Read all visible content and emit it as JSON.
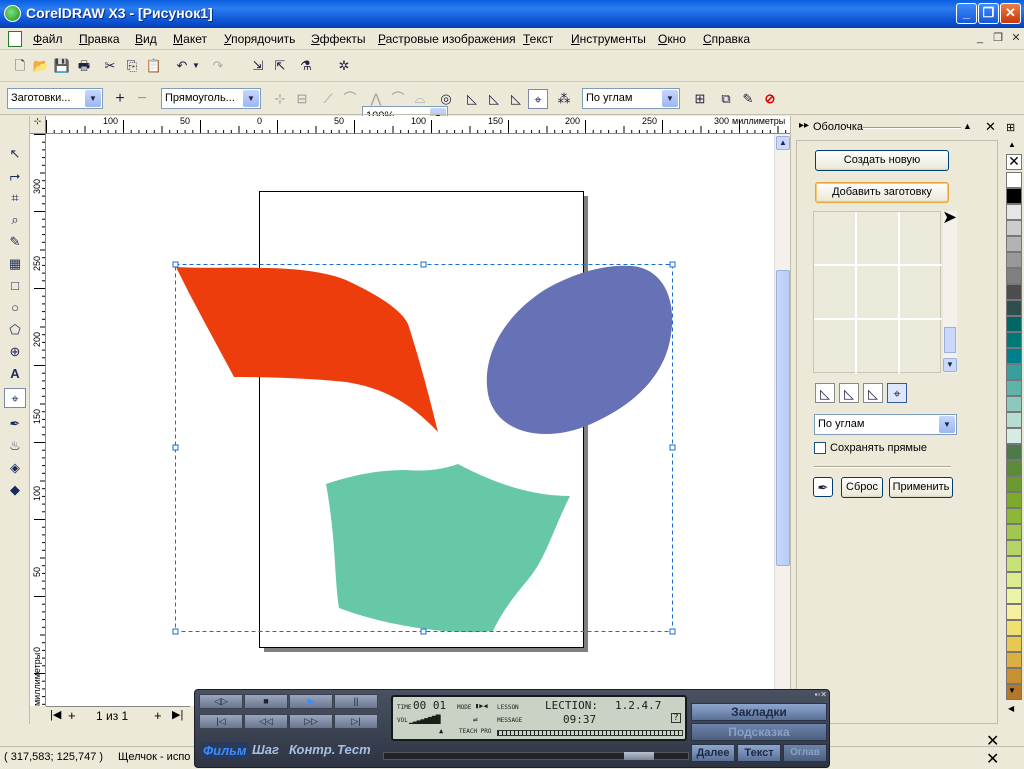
{
  "window": {
    "title": "CorelDRAW X3 - [Рисунок1]"
  },
  "menu": [
    "Файл",
    "Правка",
    "Вид",
    "Макет",
    "Упорядочить",
    "Эффекты",
    "Растровые изображения",
    "Текст",
    "Инструменты",
    "Окно",
    "Справка"
  ],
  "toolbar1": {
    "zoom": "100%"
  },
  "toolbar2": {
    "preset": "Заготовки...",
    "shape_preset": "Прямоуголь...",
    "mapping_mode": "По углам"
  },
  "ruler": {
    "h_labels": [
      "100",
      "50",
      "0",
      "50",
      "100",
      "150",
      "200",
      "250",
      "300"
    ],
    "h_unit": "миллиметры",
    "v_labels": [
      "300",
      "250",
      "200",
      "150",
      "100",
      "50",
      "0"
    ],
    "v_unit": "миллиметры"
  },
  "pagebar": {
    "page_label": "1 из 1"
  },
  "statusbar": {
    "coords": "( 317,583; 125,747 )",
    "hint": "Щелчок - испо"
  },
  "docker": {
    "title": "Оболочка",
    "create_new": "Создать новую",
    "add_preset": "Добавить заготовку",
    "mapping_mode": "По углам",
    "keep_lines": "Сохранять прямые",
    "reset": "Сброс",
    "apply": "Применить"
  },
  "colors": {
    "orange_shape": "#ee3d0c",
    "blue_shape": "#6672b5",
    "green_shape": "#66c8a6"
  },
  "palette": [
    "#ffffff",
    "#000000",
    "#e6e6e6",
    "#cccccc",
    "#b3b3b3",
    "#999999",
    "#808080",
    "#4d4d4d",
    "#2f4f4f",
    "#006666",
    "#007878",
    "#00808c",
    "#3b9e9e",
    "#5fb3a8",
    "#8cc9bc",
    "#b7ddd0",
    "#d6ece2",
    "#4c7a4c",
    "#5a8a3a",
    "#6b9a32",
    "#7caa2a",
    "#8cb83a",
    "#a0c850",
    "#b4d466",
    "#c8e07a",
    "#dceb90",
    "#ecf4a8",
    "#f6f0a0",
    "#f0e070",
    "#e8c850",
    "#dcb040",
    "#c89030",
    "#b47828"
  ],
  "player": {
    "transport": [
      "◁▷",
      "■",
      "▶",
      "||",
      "|◁",
      "◁◁",
      "▷▷",
      "▷|"
    ],
    "tabs": [
      "Фильм",
      "Шаг",
      "Контр.",
      "Тест"
    ],
    "lcd": {
      "time_label": "TIME",
      "time_value": "00 01",
      "mode_label": "MODE",
      "lesson_label": "LESSON",
      "lesson_name": "LECTION:",
      "lesson_num": "1.2.4.7",
      "vol_label": "VOL",
      "message_label": "MESSAGE",
      "clock": "09:37",
      "teach_label": "TEACH PRO"
    },
    "right": {
      "bookmarks": "Закладки",
      "hint": "Подсказка",
      "next": "Далее",
      "text": "Текст",
      "toc": "Оглав"
    }
  }
}
